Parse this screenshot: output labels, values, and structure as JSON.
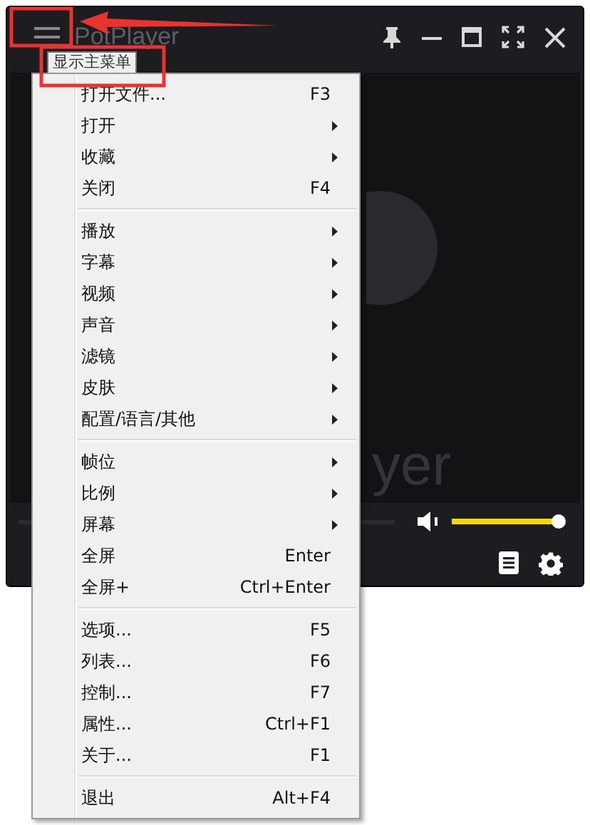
{
  "window": {
    "title": "PotPlayer"
  },
  "tooltip": "显示主菜单",
  "video": {
    "logo_text": "yer"
  },
  "volume": {
    "level": 1
  },
  "menu": {
    "groups": [
      [
        {
          "label": "打开文件...",
          "kind": "command",
          "shortcut": "F3"
        },
        {
          "label": "打开",
          "kind": "submenu"
        },
        {
          "label": "收藏",
          "kind": "submenu"
        },
        {
          "label": "关闭",
          "kind": "command",
          "shortcut": "F4"
        }
      ],
      [
        {
          "label": "播放",
          "kind": "submenu"
        },
        {
          "label": "字幕",
          "kind": "submenu"
        },
        {
          "label": "视频",
          "kind": "submenu"
        },
        {
          "label": "声音",
          "kind": "submenu"
        },
        {
          "label": "滤镜",
          "kind": "submenu"
        },
        {
          "label": "皮肤",
          "kind": "submenu"
        },
        {
          "label": "配置/语言/其他",
          "kind": "submenu"
        }
      ],
      [
        {
          "label": "帧位",
          "kind": "submenu"
        },
        {
          "label": "比例",
          "kind": "submenu"
        },
        {
          "label": "屏幕",
          "kind": "submenu"
        },
        {
          "label": "全屏",
          "kind": "command",
          "shortcut": "Enter"
        },
        {
          "label": "全屏+",
          "kind": "command",
          "shortcut": "Ctrl+Enter"
        }
      ],
      [
        {
          "label": "选项...",
          "kind": "command",
          "shortcut": "F5"
        },
        {
          "label": "列表...",
          "kind": "command",
          "shortcut": "F6"
        },
        {
          "label": "控制...",
          "kind": "command",
          "shortcut": "F7"
        },
        {
          "label": "属性...",
          "kind": "command",
          "shortcut": "Ctrl+F1"
        },
        {
          "label": "关于...",
          "kind": "command",
          "shortcut": "F1"
        }
      ],
      [
        {
          "label": "退出",
          "kind": "command",
          "shortcut": "Alt+F4"
        }
      ]
    ]
  }
}
